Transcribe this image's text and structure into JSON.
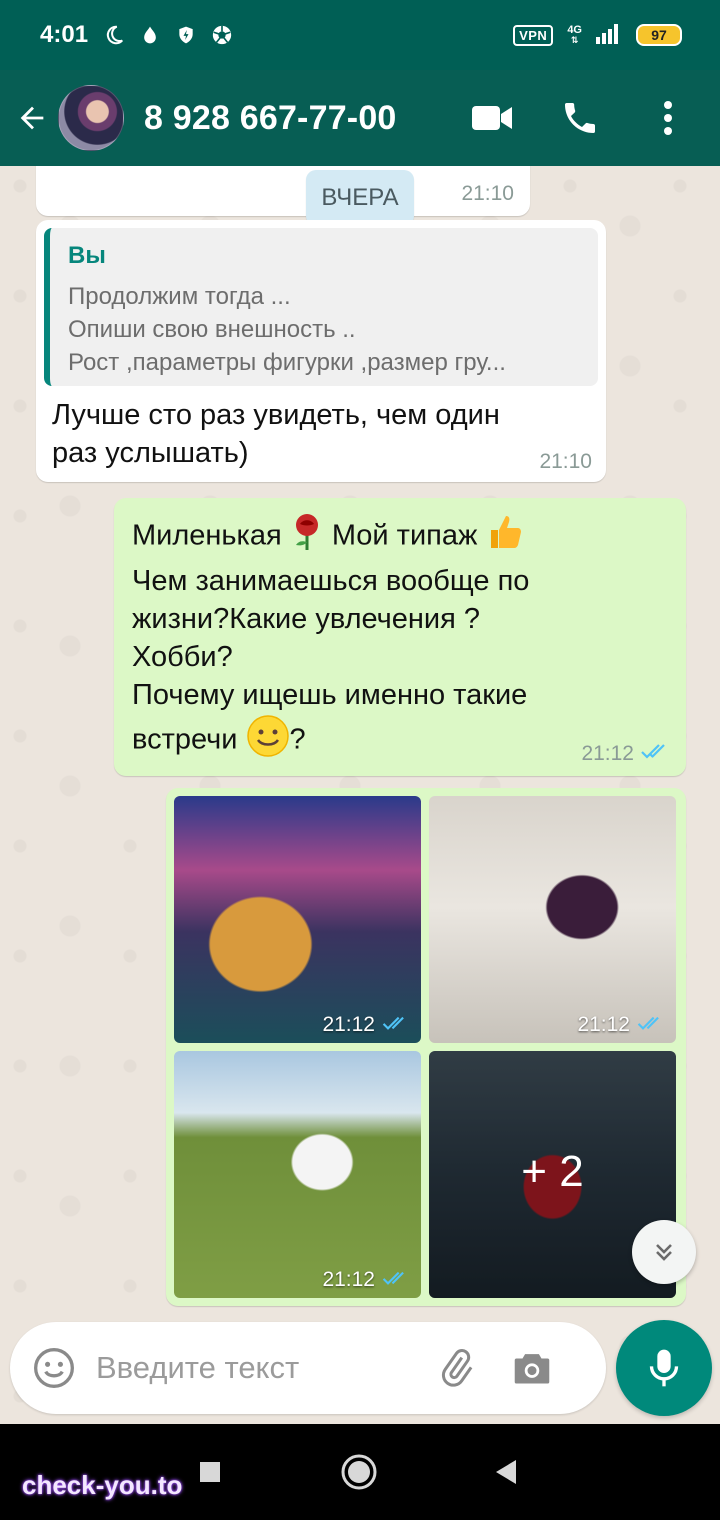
{
  "status_bar": {
    "time": "4:01",
    "vpn": "VPN",
    "network": "4G",
    "battery": "97",
    "icons": [
      "moon-icon",
      "drop-icon",
      "shield-icon",
      "aperture-icon"
    ]
  },
  "header": {
    "contact": "8 928 667-77-00",
    "actions": [
      "video-call-icon",
      "phone-call-icon",
      "more-vert-icon"
    ]
  },
  "chat": {
    "partial_time": "21:10",
    "date_chip": "ВЧЕРА",
    "reply_message": {
      "quote_author": "Вы",
      "quote_lines": [
        "Продолжим тогда  ...",
        "Опиши свою внешность ..",
        "Рост ,параметры фигурки ,размер гру..."
      ],
      "text": "Лучше сто раз увидеть, чем один раз услышать)",
      "time": "21:10"
    },
    "outgoing_message": {
      "line1_a": "Миленькая",
      "line1_b": "Мой типаж",
      "line2": "Чем занимаешься вообще по",
      "line3": "жизни?Какие увлечения ?",
      "line4": "Хобби?",
      "line5": "Почему ищешь именно такие",
      "line6_a": "встречи",
      "line6_b": "?",
      "time": "21:12",
      "status": "read"
    },
    "album": {
      "photos": [
        {
          "time": "21:12"
        },
        {
          "time": "21:12"
        },
        {
          "time": "21:12"
        },
        {
          "more": "+ 2"
        }
      ]
    }
  },
  "composer": {
    "placeholder": "Введите текст"
  },
  "watermark": "check-you.to",
  "colors": {
    "header": "#075e54",
    "statusbar": "#005f55",
    "outgoing": "#dcf8c6",
    "incoming": "#ffffff",
    "accent": "#00897b",
    "read_ticks": "#4fc3f7"
  }
}
